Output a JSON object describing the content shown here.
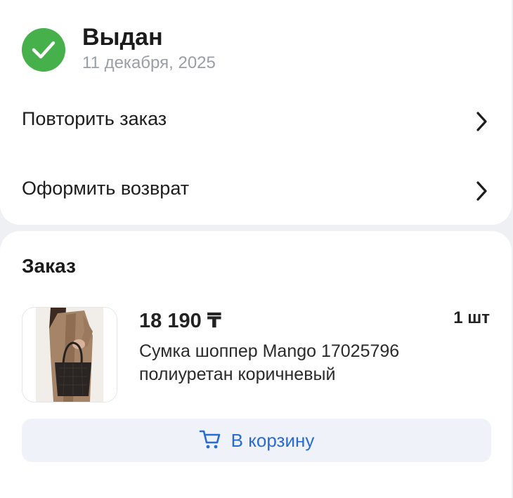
{
  "status": {
    "title": "Выдан",
    "date": "11 декабря, 2025",
    "icon": "check-circle-icon",
    "color": "#46b14a"
  },
  "actions": [
    {
      "label": "Повторить заказ",
      "icon": "chevron-right-icon"
    },
    {
      "label": "Оформить возврат",
      "icon": "chevron-right-icon"
    }
  ],
  "order": {
    "heading": "Заказ",
    "product": {
      "price": "18 190 ₸",
      "quantity": "1 шт",
      "name_line1": "Сумка шоппер Mango 17025796",
      "name_line2": "полиуретан коричневый",
      "image": "product-photo-bag"
    },
    "cart_button": {
      "label": "В корзину",
      "icon": "cart-icon",
      "color": "#2a6bd1"
    }
  }
}
